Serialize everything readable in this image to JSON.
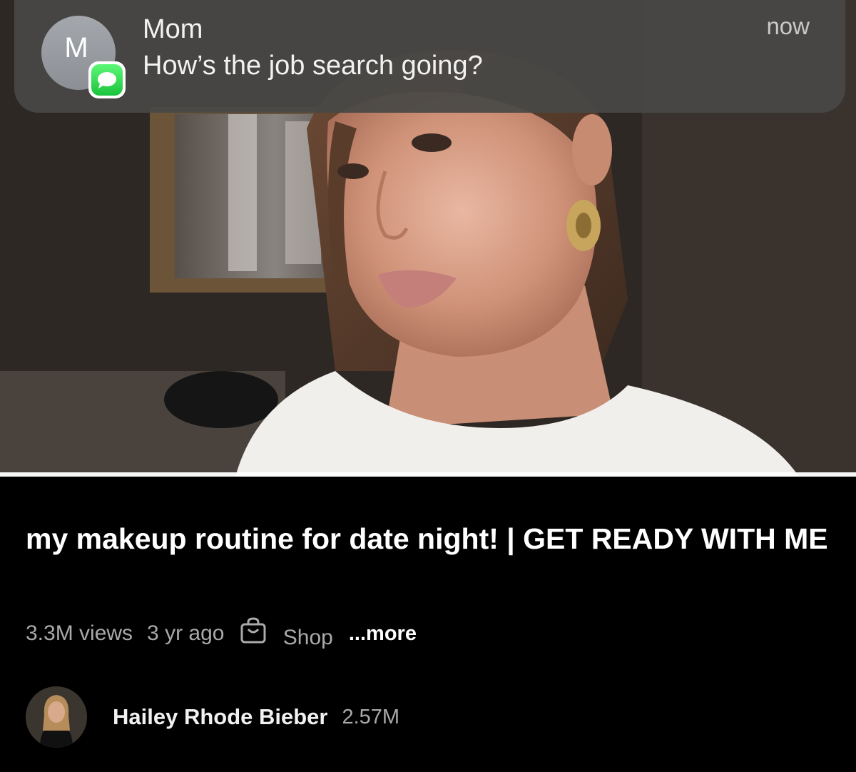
{
  "notification": {
    "avatar_letter": "M",
    "sender": "Mom",
    "message": "How’s the job search going?",
    "time": "now",
    "app_icon": "messages-icon"
  },
  "video": {
    "title": "my makeup routine for date night! | GET READY WITH ME",
    "views": "3.3M views",
    "age": "3 yr ago",
    "shop_label": "Shop",
    "more_label": "...more",
    "progress_percent": 100
  },
  "channel": {
    "name": "Hailey Rhode Bieber",
    "subscribers": "2.57M"
  },
  "colors": {
    "progress": "#ff0033",
    "messages_green": "#2fd94e",
    "meta_text": "#aaaaaa"
  }
}
